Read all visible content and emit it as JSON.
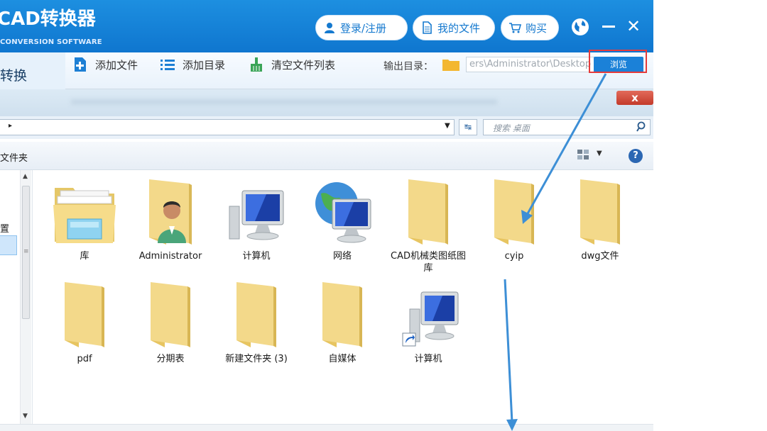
{
  "app": {
    "title": "CAD转换器",
    "subtitle": "CONVERSION SOFTWARE",
    "login_label": "登录/注册",
    "my_files_label": "我的文件",
    "buy_label": "购买"
  },
  "toolbar": {
    "left_tab_label": "转换",
    "add_file_label": "添加文件",
    "add_dir_label": "添加目录",
    "clear_list_label": "清空文件列表",
    "output_label": "输出目录：",
    "output_path": "ers\\Administrator\\Desktop",
    "browse_label": "浏览"
  },
  "dialog": {
    "close_glyph": "x",
    "search_placeholder": "搜索 桌面",
    "folder_label": "文件夹",
    "nav_text": "置"
  },
  "items": [
    {
      "label": "库",
      "icon": "library-icon"
    },
    {
      "label": "Administrator",
      "icon": "user-folder-icon"
    },
    {
      "label": "计算机",
      "icon": "computer-icon"
    },
    {
      "label": "网络",
      "icon": "network-icon"
    },
    {
      "label": "CAD机械类图纸图库",
      "icon": "folder-icon"
    },
    {
      "label": "cyip",
      "icon": "folder-icon"
    },
    {
      "label": "dwg文件",
      "icon": "folder-icon"
    },
    {
      "label": "pdf",
      "icon": "folder-icon"
    },
    {
      "label": "分期表",
      "icon": "folder-icon"
    },
    {
      "label": "新建文件夹 (3)",
      "icon": "folder-icon"
    },
    {
      "label": "自媒体",
      "icon": "folder-icon"
    },
    {
      "label": "计算机",
      "icon": "computer-shortcut-icon"
    }
  ],
  "colors": {
    "header_blue": "#0f76cf",
    "highlight_red": "#e53b3b",
    "arrow_blue": "#3d8fd6",
    "folder_yellow": "#f1d47c"
  }
}
